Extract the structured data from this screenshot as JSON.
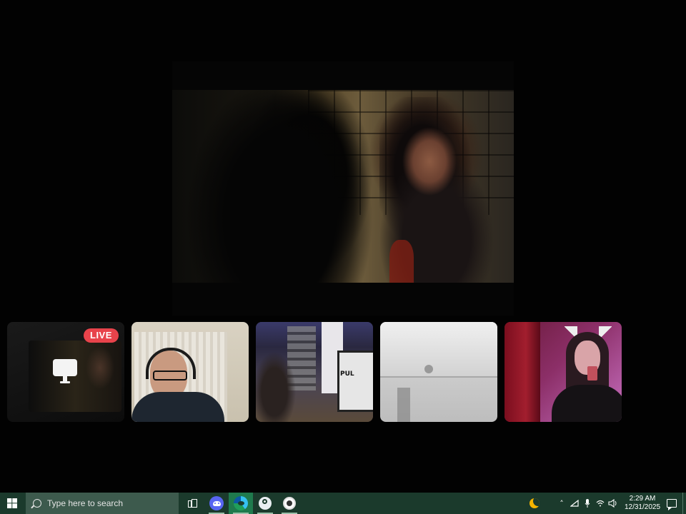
{
  "stream": {
    "live_badge": "LIVE",
    "monitor_text": "PUL"
  },
  "taskbar": {
    "start_icon": "windows-logo-icon",
    "search_placeholder": "Type here to search",
    "pinned": [
      {
        "name": "task-view-icon"
      },
      {
        "name": "discord-icon"
      },
      {
        "name": "edge-icon",
        "active": true
      },
      {
        "name": "steam-icon"
      },
      {
        "name": "obs-icon"
      }
    ],
    "tray": {
      "time": "2:29 AM",
      "date": "12/31/2025",
      "up_arrow": "˄"
    },
    "colors": {
      "bar": "#1b3a2c",
      "search_box": "#3d5a4d",
      "active_app": "#1f7a4d"
    }
  }
}
